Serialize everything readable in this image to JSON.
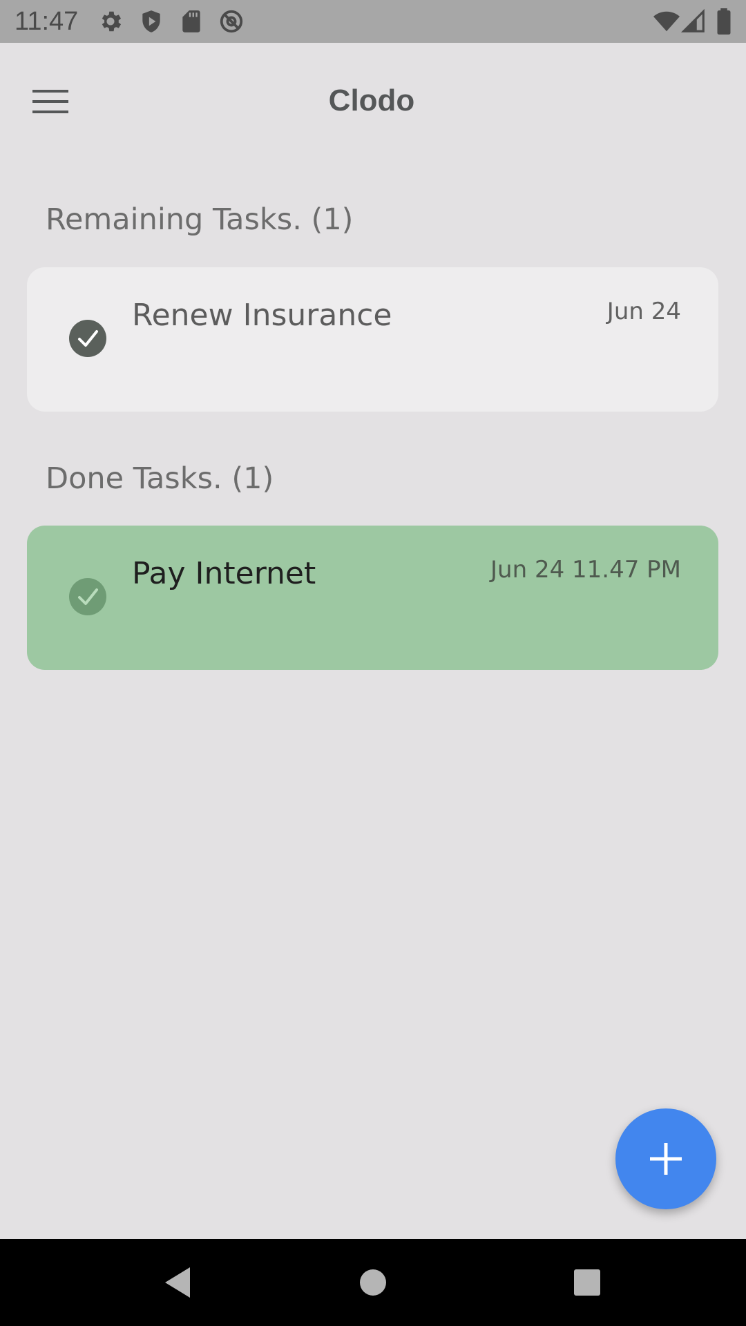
{
  "status_bar": {
    "time": "11:47",
    "left_icons": [
      "settings-icon",
      "shield-icon",
      "sd-card-icon",
      "at-sign-icon"
    ],
    "right_icons": [
      "wifi-icon",
      "signal-icon",
      "battery-icon"
    ]
  },
  "app_bar": {
    "title": "Clodo",
    "menu_icon": "hamburger-menu-icon"
  },
  "sections": {
    "remaining": {
      "header": "Remaining Tasks. (1)",
      "tasks": [
        {
          "title": "Renew Insurance",
          "date": "Jun 24",
          "status": "remaining"
        }
      ]
    },
    "done": {
      "header": "Done Tasks. (1)",
      "tasks": [
        {
          "title": "Pay Internet",
          "date": "Jun 24 11.47 PM",
          "status": "done"
        }
      ]
    }
  },
  "fab": {
    "icon": "plus-icon"
  },
  "nav_bar": {
    "icons": [
      "back-icon",
      "home-icon",
      "recents-icon"
    ]
  },
  "colors": {
    "background": "#e3e1e3",
    "status_bar": "#a7a7a7",
    "remaining_card": "#eeedee",
    "done_card": "#9dc8a2",
    "fab": "#4286ee",
    "check_dark": "#5a605b",
    "check_done": "#6f9c75"
  }
}
